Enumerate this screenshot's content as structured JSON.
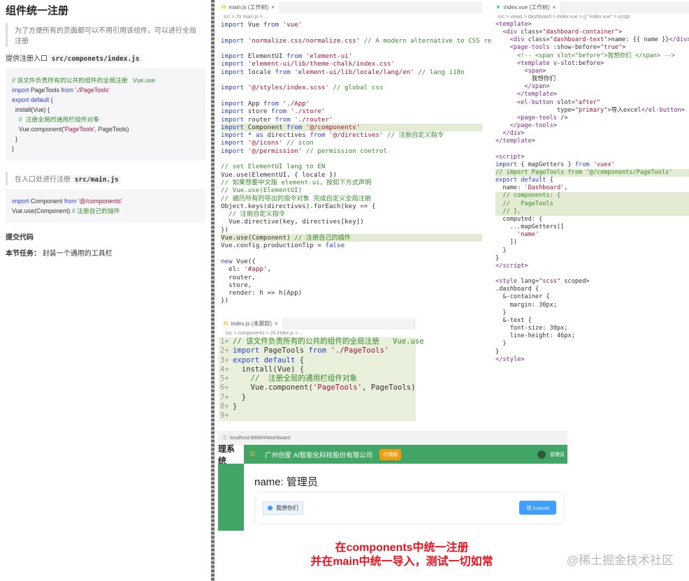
{
  "left": {
    "title": "组件统一注册",
    "quote1": "为了方便所有的页面都可以不用引用该组件，可以进行全局注册",
    "entry_label": "提供注册入口",
    "entry_path": "src/componets/index.js",
    "code1": [
      "// 该文件负责所有的公共的组件的全局注册   Vue.use",
      "import PageTools from './PageTools'",
      "export default {",
      "  install(Vue) {",
      "    //  注册全局的通用栏组件对象",
      "    Vue.component('PageTools', PageTools)",
      "  }",
      "}"
    ],
    "quote2": "在入口处进行注册",
    "quote2_path": "src/main.js",
    "code2": [
      "import Component from '@/components'",
      "Vue.use(Component) // 注册自己的插件"
    ],
    "submit": "提交代码",
    "task_label": "本节任务：",
    "task_text": "封装一个通用的工具栏"
  },
  "mainjs": {
    "tab": "main.js (工作树)",
    "crumb": "src > JS main.js > ...",
    "lines": [
      "import Vue from 'vue'",
      "",
      "import 'normalize.css/normalize.css' // A modern alternative to CSS resets",
      "",
      "import ElementUI from 'element-ui'",
      "import 'element-ui/lib/theme-chalk/index.css'",
      "import locale from 'element-ui/lib/locale/lang/en' // lang i18n",
      "",
      "import '@/styles/index.scss' // global css",
      "",
      "import App from './App'",
      "import store from './store'",
      "import router from './router'",
      "import Component from '@/components'",
      "import * as directives from '@/directives' // 注册自定义指令",
      "import '@/icons' // icon",
      "import '@/permission' // permission control",
      "",
      "// set ElementUI lang to EN",
      "Vue.use(ElementUI, { locale })",
      "// 如果想要中文版 element-ui，按如下方式声明",
      "// Vue.use(ElementUI)",
      "// 遍历所有的导出的指令对象 完成自定义全局注册",
      "Object.keys(directives).forEach(key => {",
      "  // 注册自定义指令",
      "  Vue.directive(key, directives[key])",
      "})",
      "Vue.use(Component) // 注册自己的插件",
      "Vue.config.productionTip = false",
      "",
      "new Vue({",
      "  el: '#app',",
      "  router,",
      "  store,",
      "  render: h => h(App)",
      "})"
    ],
    "highlight": [
      13,
      27
    ]
  },
  "vue": {
    "tab": "index.vue (工作树)",
    "crumb": "src > views > dashboard > index.vue > {} \"index.vue\" > script",
    "lines": [
      "<template>",
      "  <div class=\"dashboard-container\">",
      "    <div class=\"dashboard-text\">name: {{ name }}</div>",
      "    <page-tools :show-before=\"true\">",
      "      <!-- <span slot=\"before\">我想你们 </span> -->",
      "      <template v-slot:before>",
      "        <span>",
      "          我想你们",
      "        </span>",
      "      </template>",
      "      <el-button slot=\"after\"",
      "                 type=\"primary\">导入excel</el-button>",
      "      <page-tools />",
      "    </page-tools>",
      "  </div>",
      "</template>",
      "",
      "<script>",
      "import { mapGetters } from 'vuex'",
      "// import PageTools from '@/components/PageTools'",
      "export default {",
      "  name: 'Dashboard',",
      "  // components: {",
      "  //   PageTools",
      "  // },",
      "  computed: {",
      "    ...mapGetters([",
      "      'name'",
      "    ])",
      "  }",
      "}",
      "</script>",
      "",
      "<style lang=\"scss\" scoped>",
      ".dashboard {",
      "  &-container {",
      "    margin: 30px;",
      "  }",
      "  &-text {",
      "    font-size: 30px;",
      "    line-height: 46px;",
      "  }",
      "}",
      "</style>"
    ],
    "highlight": [
      19,
      22,
      23,
      24
    ]
  },
  "idxjs": {
    "tab": "index.js (未跟踪)",
    "crumb": "src > components > JS index.js > ...",
    "lines": [
      "// 该文件负责所有的公共的组件的全局注册   Vue.use",
      "import PageTools from './PageTools'",
      "export default {",
      "  install(Vue) {",
      "    //  注册全局的通用栏组件对象",
      "    Vue.component('PageTools', PageTools)",
      "  }",
      "}",
      ""
    ]
  },
  "browser": {
    "url": "localhost:8888/#/dashboard",
    "brand": "理系统",
    "company": "广州创星 AI智能化科技股份有限公司",
    "badge": "内测版",
    "user": "管理员",
    "dash_text": "name: 管理员",
    "tag": "我想你们",
    "button": "导入excel"
  },
  "caption": {
    "line1": "在components中统一注册",
    "line2": "并在main中统一导入，测试一切如常"
  },
  "watermark": "@稀土掘金技术社区"
}
